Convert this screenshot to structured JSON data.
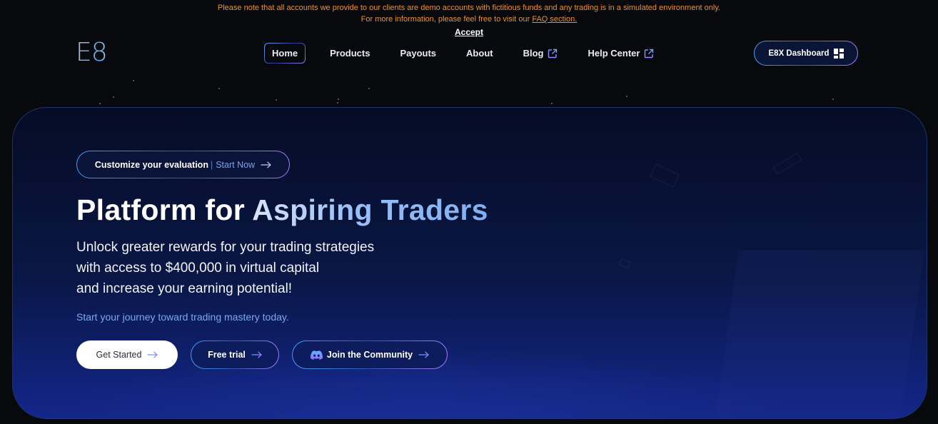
{
  "notice": {
    "line1": "Please note that all accounts we provide to our clients are demo accounts with fictitious funds and any trading is in a simulated environment only.",
    "line2_prefix": "For more information, please feel free to visit our ",
    "line2_link": "FAQ section.",
    "accept_label": "Accept"
  },
  "header": {
    "logo": "E8",
    "nav": [
      {
        "label": "Home",
        "active": true,
        "external": false
      },
      {
        "label": "Products",
        "active": false,
        "external": false
      },
      {
        "label": "Payouts",
        "active": false,
        "external": false
      },
      {
        "label": "About",
        "active": false,
        "external": false
      },
      {
        "label": "Blog",
        "active": false,
        "external": true
      },
      {
        "label": "Help Center",
        "active": false,
        "external": true
      }
    ],
    "dashboard_label": "E8X Dashboard"
  },
  "hero": {
    "eval_pill": {
      "strong": "Customize your evaluation",
      "separator": "|",
      "cta": "Start Now"
    },
    "title_plain": "Platform for ",
    "title_highlight": "Aspiring Traders",
    "subtitle_lines": [
      "Unlock greater rewards for your trading strategies",
      "with access to $400,000 in virtual capital",
      "and increase your earning potential!"
    ],
    "tagline": "Start your journey toward trading mastery today.",
    "buttons": {
      "get_started": "Get Started",
      "free_trial": "Free trial",
      "community": "Join the Community"
    }
  },
  "colors": {
    "notice": "#e8922c",
    "accent_blue": "#3fa0ff",
    "accent_purple": "#a77cff",
    "tagline": "#7ca8f0",
    "hero_bottom": "#13268a"
  }
}
